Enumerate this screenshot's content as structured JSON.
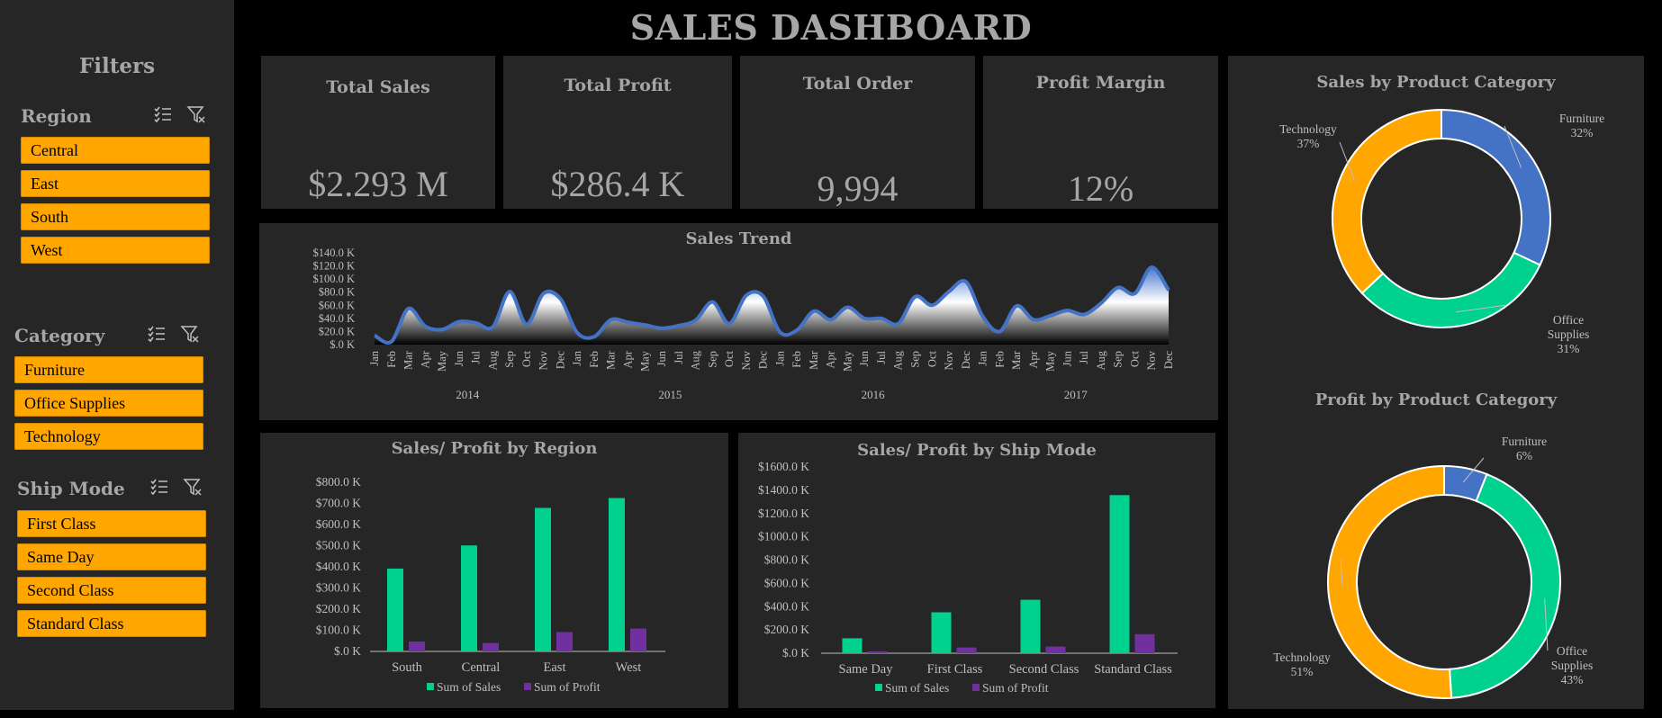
{
  "title": "SALES DASHBOARD",
  "colors": {
    "accent": "#ffa600",
    "blue": "#4472c4",
    "green": "#00d18f",
    "purple": "#7030a0",
    "panel": "#262626"
  },
  "filters": {
    "title": "Filters",
    "slicers": [
      {
        "title": "Region",
        "items": [
          "Central",
          "East",
          "South",
          "West"
        ]
      },
      {
        "title": "Category",
        "items": [
          "Furniture",
          "Office Supplies",
          "Technology"
        ]
      },
      {
        "title": "Ship Mode",
        "items": [
          "First Class",
          "Same Day",
          "Second Class",
          "Standard Class"
        ]
      }
    ],
    "icons": {
      "multi_select": "multi-select-icon",
      "clear_filter": "clear-filter-icon"
    }
  },
  "kpis": [
    {
      "label": "Total Sales",
      "value": "$2.293 M"
    },
    {
      "label": "Total Profit",
      "value": "$286.4 K"
    },
    {
      "label": "Total Order",
      "value": "9,994"
    },
    {
      "label": "Profit Margin",
      "value": "12%"
    }
  ],
  "chart_data": [
    {
      "type": "area",
      "title": "Sales Trend",
      "ylim": [
        0,
        140000
      ],
      "yticks": [
        "$.0 K",
        "$20.0 K",
        "$40.0 K",
        "$60.0 K",
        "$80.0 K",
        "$100.0 K",
        "$120.0 K",
        "$140.0 K"
      ],
      "months": [
        "Jan",
        "Feb",
        "Mar",
        "Apr",
        "May",
        "Jun",
        "Jul",
        "Aug",
        "Sep",
        "Oct",
        "Nov",
        "Dec"
      ],
      "years": [
        "2014",
        "2015",
        "2016",
        "2017"
      ],
      "values": [
        14000,
        4500,
        55000,
        28000,
        23000,
        35000,
        33000,
        27000,
        81000,
        31000,
        78000,
        70000,
        18000,
        12000,
        38000,
        34000,
        30000,
        25000,
        29000,
        37000,
        65000,
        32000,
        75000,
        74000,
        19000,
        22000,
        51000,
        38000,
        57000,
        40000,
        40000,
        32000,
        73000,
        60000,
        81000,
        96000,
        43000,
        20000,
        59000,
        38000,
        44000,
        52000,
        46000,
        63000,
        87000,
        78000,
        118000,
        83000
      ]
    },
    {
      "type": "bar",
      "title": "Sales/ Profit by Region",
      "categories": [
        "South",
        "Central",
        "East",
        "West"
      ],
      "ylim": [
        0,
        800000
      ],
      "yticks": [
        "$.0 K",
        "$100.0 K",
        "$200.0 K",
        "$300.0 K",
        "$400.0 K",
        "$500.0 K",
        "$600.0 K",
        "$700.0 K",
        "$800.0 K"
      ],
      "series": [
        {
          "name": "Sum of Sales",
          "values": [
            391722,
            501240,
            678781,
            725458
          ]
        },
        {
          "name": "Sum of Profit",
          "values": [
            46749,
            39706,
            91523,
            108418
          ]
        }
      ],
      "legend": "bottom"
    },
    {
      "type": "bar",
      "title": "Sales/ Profit by Ship Mode",
      "categories": [
        "Same Day",
        "First Class",
        "Second Class",
        "Standard Class"
      ],
      "ylim": [
        0,
        1600000
      ],
      "yticks": [
        "$.0 K",
        "$200.0 K",
        "$400.0 K",
        "$600.0 K",
        "$800.0 K",
        "$1000.0 K",
        "$1200.0 K",
        "$1400.0 K",
        "$1600.0 K"
      ],
      "series": [
        {
          "name": "Sum of Sales",
          "values": [
            128363,
            351428,
            459194,
            1358216
          ]
        },
        {
          "name": "Sum of Profit",
          "values": [
            15892,
            48970,
            57447,
            164089
          ]
        }
      ],
      "legend": "bottom"
    },
    {
      "type": "pie",
      "title": "Sales by Product Category",
      "slices": [
        {
          "name": "Furniture",
          "value": 32,
          "label": "Furniture 32%"
        },
        {
          "name": "Office Supplies",
          "value": 31,
          "label": "Office Supplies 31%"
        },
        {
          "name": "Technology",
          "value": 37,
          "label": "Technology 37%"
        }
      ]
    },
    {
      "type": "pie",
      "title": "Profit by Product Category",
      "slices": [
        {
          "name": "Furniture",
          "value": 6,
          "label": "Furniture 6%"
        },
        {
          "name": "Office Supplies",
          "value": 43,
          "label": "Office Supplies 43%"
        },
        {
          "name": "Technology",
          "value": 51,
          "label": "Technology 51%"
        }
      ]
    }
  ]
}
